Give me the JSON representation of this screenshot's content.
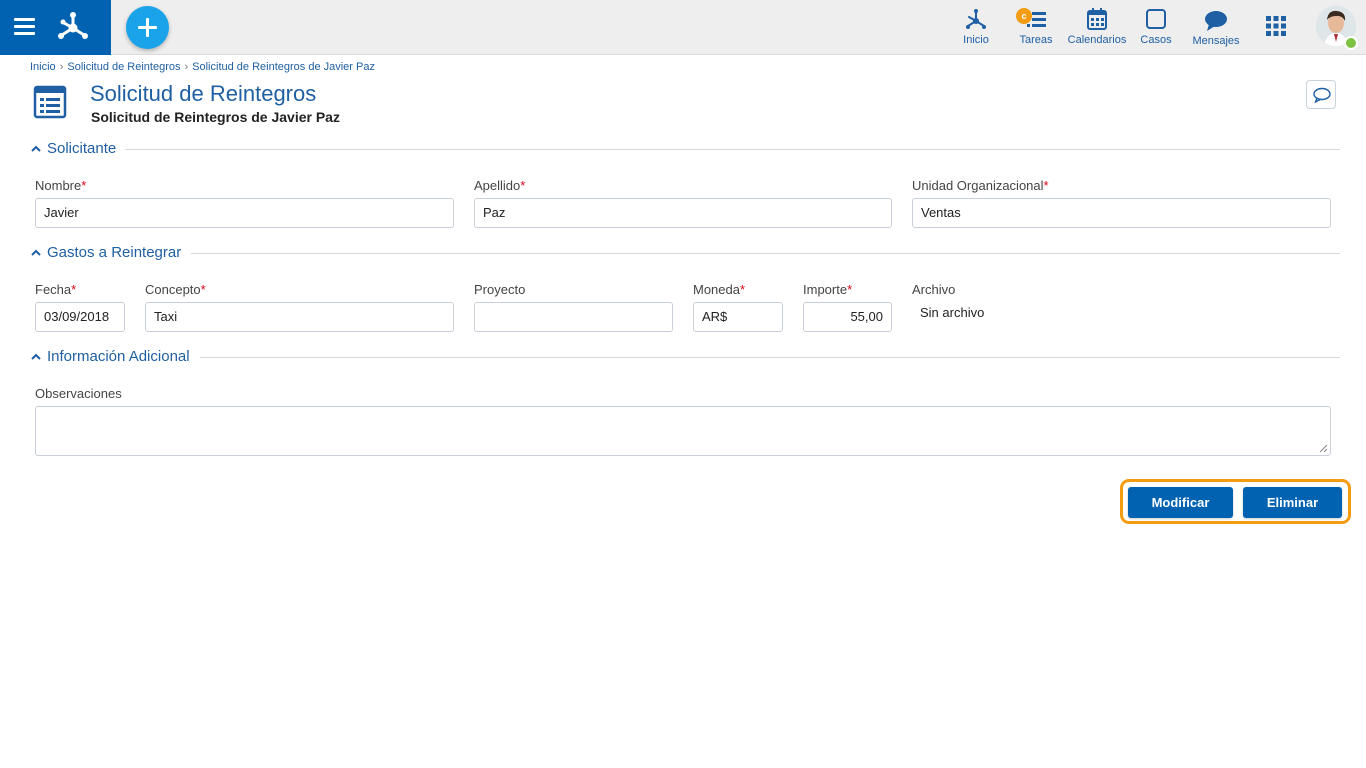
{
  "nav": {
    "items": [
      {
        "label": "Inicio",
        "icon": "process-icon"
      },
      {
        "label": "Tareas",
        "icon": "tasks-icon"
      },
      {
        "label": "Calendarios",
        "icon": "calendar-icon"
      },
      {
        "label": "Casos",
        "icon": "cases-icon"
      },
      {
        "label": "Mensajes",
        "icon": "messages-icon"
      }
    ],
    "tasks_badge": "c"
  },
  "breadcrumb": [
    "Inicio",
    "Solicitud de Reintegros",
    "Solicitud de Reintegros de Javier Paz"
  ],
  "header": {
    "title": "Solicitud de Reintegros",
    "subtitle": "Solicitud de Reintegros de Javier Paz"
  },
  "sections": {
    "solicitante": {
      "title": "Solicitante",
      "nombre_label": "Nombre",
      "nombre_value": "Javier",
      "apellido_label": "Apellido",
      "apellido_value": "Paz",
      "unidad_label": "Unidad Organizacional",
      "unidad_value": "Ventas"
    },
    "gastos": {
      "title": "Gastos a Reintegrar",
      "fecha_label": "Fecha",
      "fecha_value": "03/09/2018",
      "concepto_label": "Concepto",
      "concepto_value": "Taxi",
      "proyecto_label": "Proyecto",
      "proyecto_value": "",
      "moneda_label": "Moneda",
      "moneda_value": "AR$",
      "importe_label": "Importe",
      "importe_value": "55,00",
      "archivo_label": "Archivo",
      "archivo_value": "Sin archivo"
    },
    "adicional": {
      "title": "Información Adicional",
      "observaciones_label": "Observaciones",
      "observaciones_value": ""
    }
  },
  "required_mark": "*",
  "actions": {
    "modify_label": "Modificar",
    "delete_label": "Eliminar"
  },
  "colors": {
    "brand": "#0062b1",
    "accent": "#1aa3e8",
    "highlight": "#f39c12",
    "required": "#d9001b"
  }
}
